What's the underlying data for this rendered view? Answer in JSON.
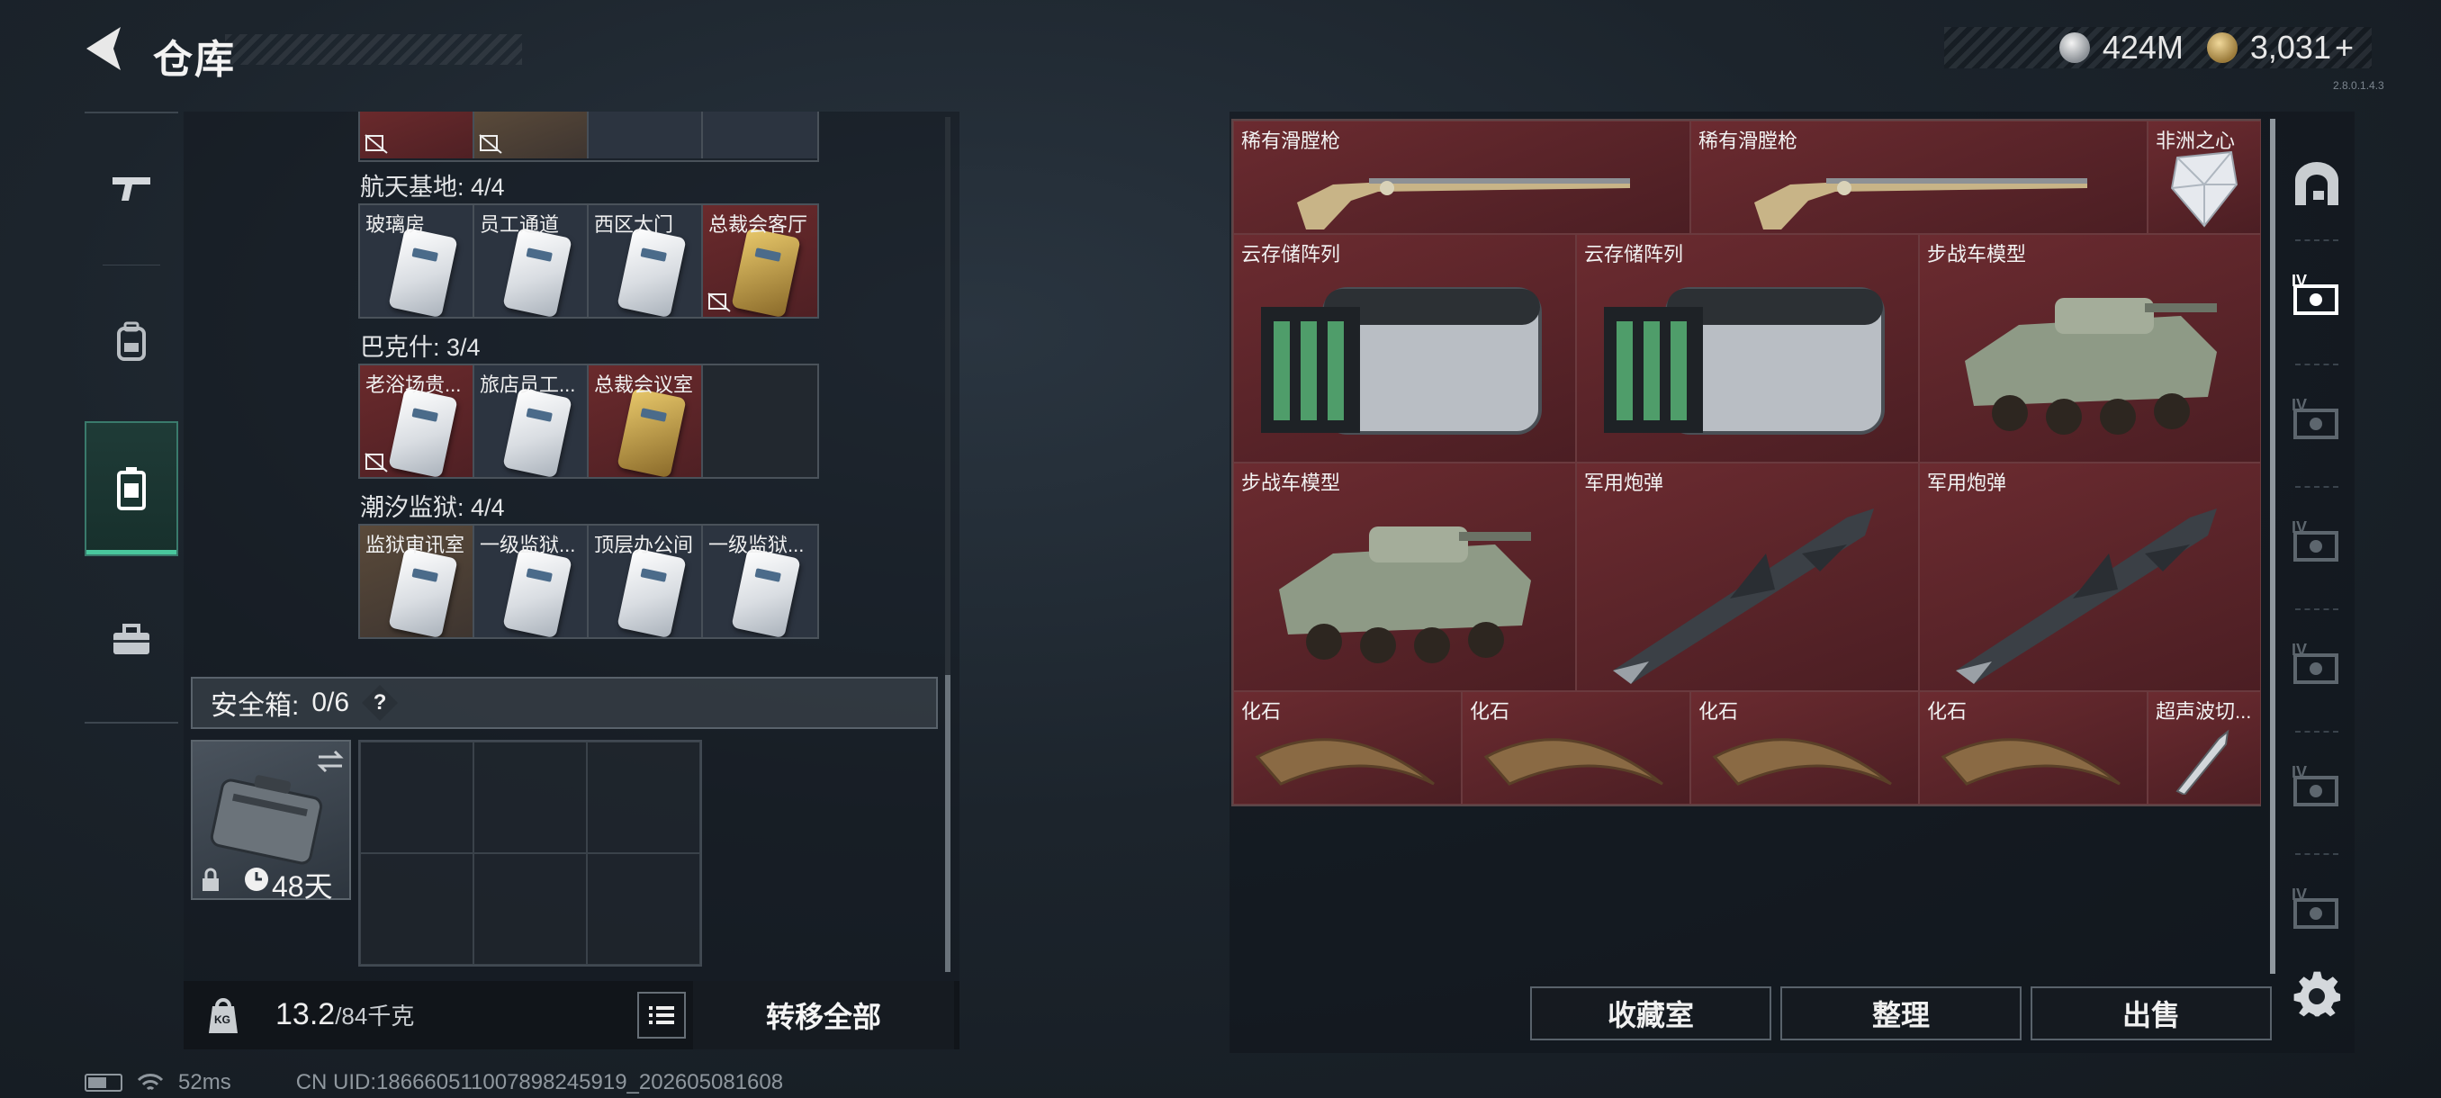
{
  "header": {
    "title": "仓库",
    "currency_silver": "424M",
    "currency_gold": "3,031",
    "currency_plus": "+"
  },
  "left_rail": {
    "tabs": [
      {
        "icon": "gun-icon"
      },
      {
        "icon": "backpack-icon"
      },
      {
        "icon": "stash-case-icon",
        "active": true
      },
      {
        "icon": "toolbox-icon"
      }
    ]
  },
  "key_groups": [
    {
      "title": "航天基地: 4/4",
      "keys": [
        {
          "label": "玻璃房",
          "style": "normal"
        },
        {
          "label": "员工通道",
          "style": "normal"
        },
        {
          "label": "西区大门",
          "style": "normal"
        },
        {
          "label": "总裁会客厅",
          "style": "red",
          "no_share": true
        }
      ]
    },
    {
      "title": "巴克什: 3/4",
      "keys": [
        {
          "label": "老浴场贵...",
          "style": "red",
          "no_share": true
        },
        {
          "label": "旅店员工...",
          "style": "normal"
        },
        {
          "label": "总裁会议室",
          "style": "red",
          "gold": true
        },
        {
          "label": "",
          "style": "empty"
        }
      ]
    },
    {
      "title": "潮汐监狱: 4/4",
      "keys": [
        {
          "label": "监狱审讯室",
          "style": "brown"
        },
        {
          "label": "一级监狱...",
          "style": "normal"
        },
        {
          "label": "顶层办公间",
          "style": "normal"
        },
        {
          "label": "一级监狱...",
          "style": "normal"
        }
      ]
    }
  ],
  "safe_box": {
    "title": "安全箱:",
    "count": "0/6",
    "help": "?",
    "duration": "48天"
  },
  "bottom_bar": {
    "weight_current": "13.2",
    "weight_max": "/84千克",
    "weight_icon_text": "KG",
    "transfer_all": "转移全部"
  },
  "status": {
    "ping": "52ms",
    "uid": "CN UID:18666051100789824​5919_202605081608"
  },
  "stash_items": [
    {
      "label": "稀有滑膛枪",
      "kind": "musket"
    },
    {
      "label": "稀有滑膛枪",
      "kind": "musket"
    },
    {
      "label": "非洲之心",
      "kind": "gem"
    },
    {
      "label": "云存储阵列",
      "kind": "server"
    },
    {
      "label": "云存储阵列",
      "kind": "server"
    },
    {
      "label": "步战车模型",
      "kind": "ifv"
    },
    {
      "label": "步战车模型",
      "kind": "ifv"
    },
    {
      "label": "军用炮弹",
      "kind": "missile"
    },
    {
      "label": "军用炮弹",
      "kind": "missile"
    },
    {
      "label": "化石",
      "kind": "claw"
    },
    {
      "label": "化石",
      "kind": "claw"
    },
    {
      "label": "化石",
      "kind": "claw"
    },
    {
      "label": "化石",
      "kind": "claw"
    },
    {
      "label": "超声波切...",
      "kind": "scalpel"
    }
  ],
  "right_rail": {
    "tiers": [
      "IV",
      "IV",
      "IV",
      "IV",
      "IV",
      "IV"
    ]
  },
  "actions": {
    "collection": "收藏室",
    "sort": "整理",
    "sell": "出售"
  },
  "version_text": "2.8.0.1.4.3",
  "colors": {
    "item_red": "#6b2b30",
    "accent_teal": "#49c79d"
  }
}
